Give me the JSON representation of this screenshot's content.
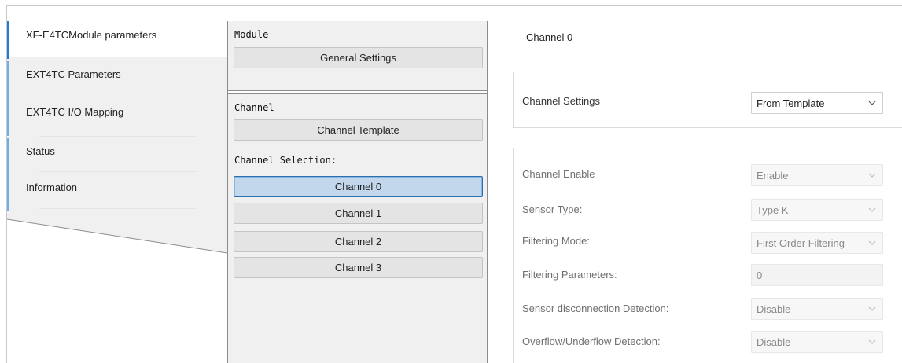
{
  "nav": {
    "items": [
      {
        "label": "XF-E4TCModule parameters",
        "active": true
      },
      {
        "label": "EXT4TC Parameters",
        "active": false
      },
      {
        "label": "EXT4TC I/O Mapping",
        "active": false
      },
      {
        "label": "Status",
        "active": false
      },
      {
        "label": "Information",
        "active": false
      }
    ]
  },
  "middle": {
    "module_label": "Module",
    "general_settings": "General Settings",
    "channel_label": "Channel",
    "channel_template": "Channel Template",
    "selection_label": "Channel Selection:",
    "channels": [
      "Channel 0",
      "Channel 1",
      "Channel 2",
      "Channel 3"
    ],
    "selected_channel": "Channel 0"
  },
  "right": {
    "title": "Channel 0",
    "channel_settings": {
      "label": "Channel Settings",
      "value": "From Template"
    },
    "params": [
      {
        "label": "Channel Enable",
        "value": "Enable",
        "kind": "select"
      },
      {
        "label": "Sensor Type:",
        "value": "Type K",
        "kind": "select"
      },
      {
        "label": "Filtering Mode:",
        "value": "First Order Filtering",
        "kind": "select"
      },
      {
        "label": "Filtering Parameters:",
        "value": "0",
        "kind": "input"
      },
      {
        "label": "Sensor disconnection Detection:",
        "value": "Disable",
        "kind": "select"
      },
      {
        "label": "Overflow/Underflow Detection:",
        "value": "Disable",
        "kind": "select"
      }
    ]
  },
  "colors": {
    "accent_bar": "#1f7ad9",
    "nav_bar": "#6bb0e8",
    "selected_button": "#c2d7ec",
    "panel_bg": "#f0f0f0"
  },
  "icons": {
    "dropdown": "chevron-down-icon"
  }
}
